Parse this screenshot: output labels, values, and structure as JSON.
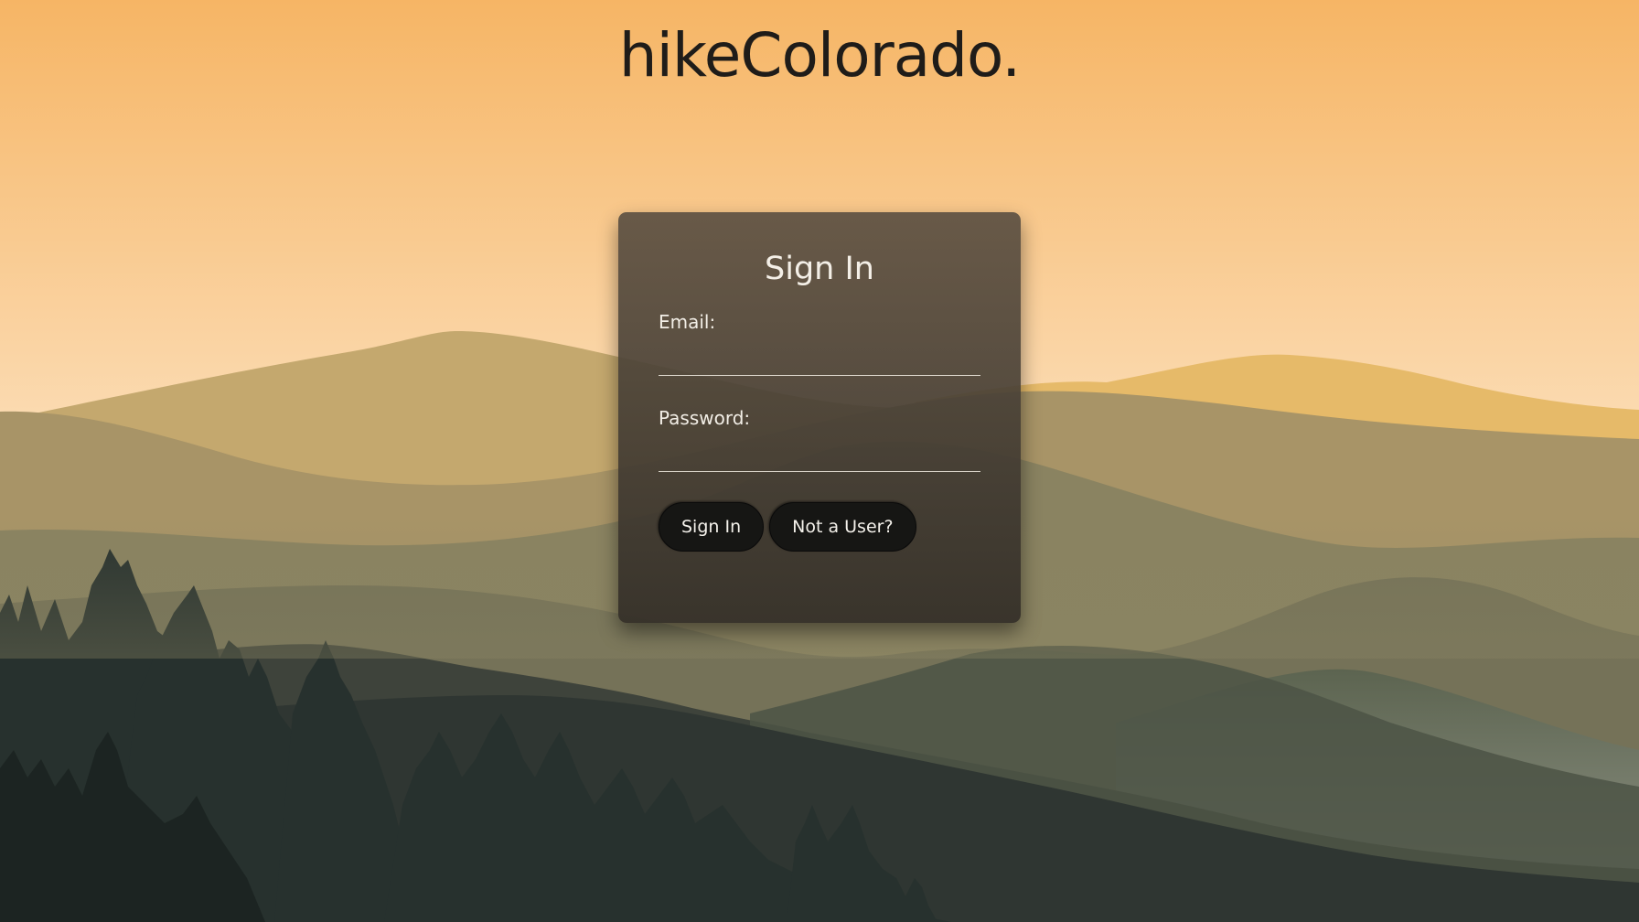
{
  "site": {
    "title": "hikeColorado."
  },
  "signin": {
    "title": "Sign In",
    "email_label": "Email:",
    "email_value": "",
    "password_label": "Password:",
    "password_value": "",
    "signin_button": "Sign In",
    "not_user_button": "Not a User?"
  },
  "colors": {
    "sky_top": "#f6b565",
    "sky_bottom": "#fde6c8",
    "button_bg": "#161614",
    "card_bg": "#574c40",
    "title_text": "#1f1c19"
  }
}
